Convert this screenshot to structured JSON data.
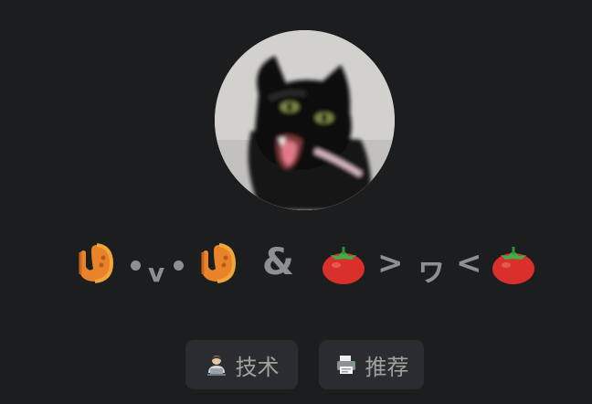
{
  "profile": {
    "avatar_icon": "black-cat-avatar",
    "title": {
      "face_left": "•ᴗ•",
      "ampersand": "&",
      "gt": ">",
      "mouth": "ヮ",
      "lt": "<",
      "icons": [
        "shrimp-icon",
        "tomato-icon"
      ]
    }
  },
  "tags": [
    {
      "label": "技术",
      "icon": "technologist-icon"
    },
    {
      "label": "推荐",
      "icon": "printer-icon"
    }
  ],
  "colors": {
    "background": "#1c1d1f",
    "button_background": "#2b2c2f",
    "text": "#8e8f91",
    "shrimp": "#e8832a",
    "tomato": "#d9302c",
    "tomato_leaf": "#3fae49"
  }
}
